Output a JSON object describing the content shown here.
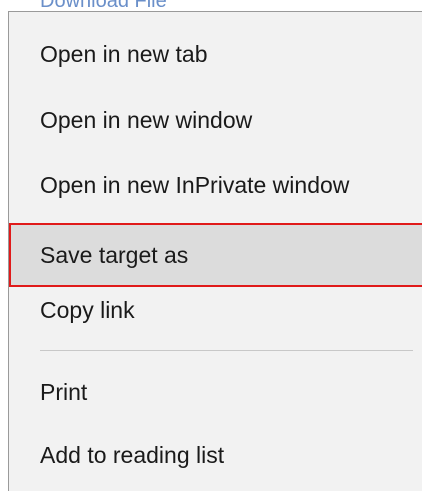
{
  "background": {
    "partial_link_text": "Download File"
  },
  "context_menu": {
    "items": [
      {
        "label": "Open in new tab"
      },
      {
        "label": "Open in new window"
      },
      {
        "label": "Open in new InPrivate window"
      },
      {
        "label": "Save target as"
      },
      {
        "label": "Copy link"
      },
      {
        "label": "Print"
      },
      {
        "label": "Add to reading list"
      }
    ],
    "highlighted_item": "Save target as",
    "highlight_color": "#e01a1a",
    "menu_background": "#f2f2f2"
  }
}
